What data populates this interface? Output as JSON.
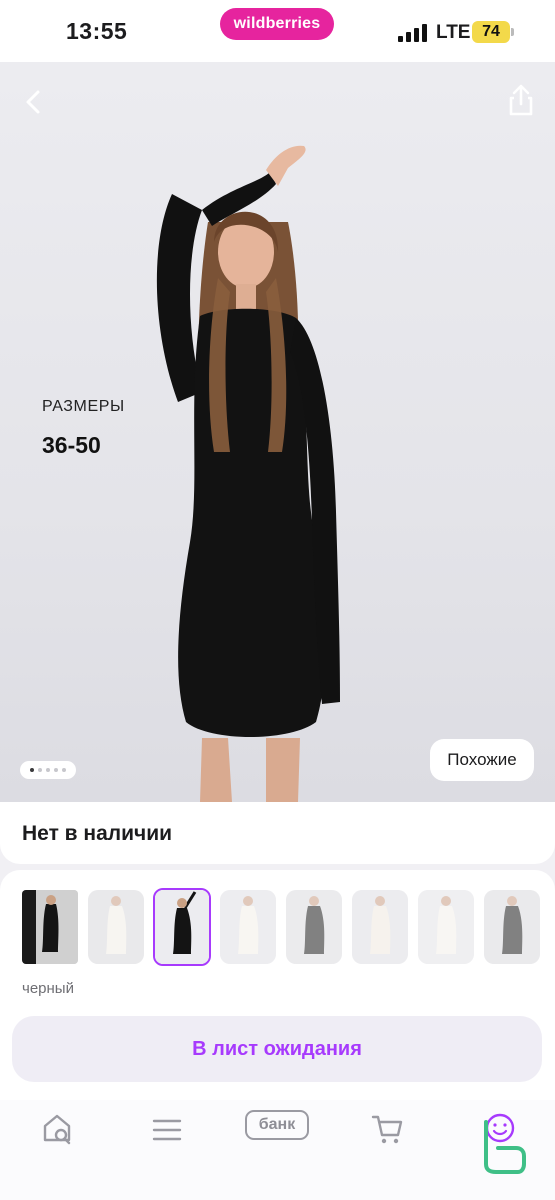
{
  "status_bar": {
    "time": "13:55",
    "brand": "wildberries",
    "network": "LTE",
    "battery": "74"
  },
  "product_image": {
    "sizes_caption": "РАЗМЕРЫ",
    "sizes_value": "36-50",
    "similar_button": "Похожие",
    "carousel_dots": 5,
    "carousel_active": 1,
    "icons": {
      "back": "chevron-left-icon",
      "share": "share-icon"
    }
  },
  "availability": {
    "status": "Нет в наличии"
  },
  "variants": {
    "selected_color": "черный",
    "selected_index": 2,
    "count": 8
  },
  "actions": {
    "waitlist_button": "В лист ожидания"
  },
  "bottom_nav": {
    "items": [
      {
        "name": "home",
        "icon": "home-search-icon"
      },
      {
        "name": "catalog",
        "icon": "menu-icon"
      },
      {
        "name": "bank",
        "label": "банк"
      },
      {
        "name": "cart",
        "icon": "cart-icon"
      },
      {
        "name": "profile",
        "icon": "profile-smile-icon"
      }
    ]
  },
  "colors": {
    "brand": "#e6249e",
    "accent": "#a73afd",
    "battery": "#f3d94a"
  }
}
